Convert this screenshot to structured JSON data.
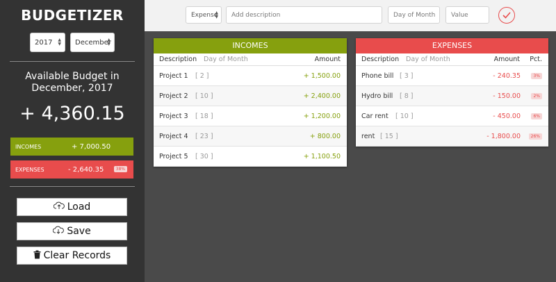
{
  "app": {
    "title": "BUDGETIZER"
  },
  "filters": {
    "year": "2017",
    "month": "December"
  },
  "summary": {
    "available_label": "Available Budget in",
    "available_period": "December, 2017",
    "total": "+ 4,360.15",
    "income_label": "INCOMES",
    "income_value": "+ 7,000.50",
    "expense_label": "EXPENSES",
    "expense_value": "- 2,640.35",
    "expense_pct": "38%"
  },
  "actions": {
    "load": "Load",
    "save": "Save",
    "clear": "Clear Records"
  },
  "entry_form": {
    "type": "Expense",
    "description_placeholder": "Add description",
    "day_placeholder": "Day of Month",
    "value_placeholder": "Value"
  },
  "incomes": {
    "title": "INCOMES",
    "columns": {
      "description": "Description",
      "day": "Day of Month",
      "amount": "Amount"
    },
    "rows": [
      {
        "description": "Project 1",
        "day": "[ 2 ]",
        "amount": "+ 1,500.00"
      },
      {
        "description": "Project 2",
        "day": "[ 10 ]",
        "amount": "+ 2,400.00"
      },
      {
        "description": "Project 3",
        "day": "[ 18 ]",
        "amount": "+ 1,200.00"
      },
      {
        "description": "Project 4",
        "day": "[ 23 ]",
        "amount": "+ 800.00"
      },
      {
        "description": "Project 5",
        "day": "[ 30 ]",
        "amount": "+ 1,100.50"
      }
    ]
  },
  "expenses": {
    "title": "EXPENSES",
    "columns": {
      "description": "Description",
      "day": "Day of Month",
      "amount": "Amount",
      "pct": "Pct."
    },
    "rows": [
      {
        "description": "Phone bill",
        "day": "[ 3 ]",
        "amount": "- 240.35",
        "pct": "3%"
      },
      {
        "description": "Hydro bill",
        "day": "[ 8 ]",
        "amount": "- 150.00",
        "pct": "2%"
      },
      {
        "description": "Car rent",
        "day": "[ 10 ]",
        "amount": "- 450.00",
        "pct": "6%"
      },
      {
        "description": "rent",
        "day": "[ 15 ]",
        "amount": "- 1,800.00",
        "pct": "26%"
      }
    ]
  },
  "colors": {
    "income": "#86a00e",
    "expense": "#e84c4c",
    "sidebar": "#333333"
  },
  "icons": {
    "load": "cloud-upload-icon",
    "save": "cloud-download-icon",
    "clear": "trash-icon",
    "submit": "check-circle-icon"
  }
}
